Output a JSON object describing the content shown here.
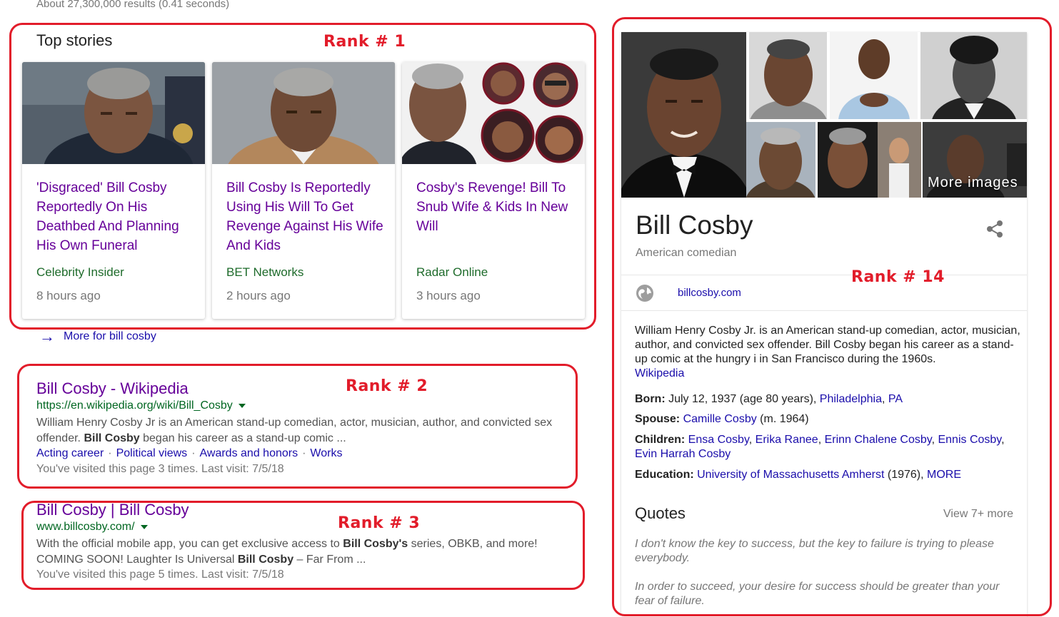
{
  "results_stats": "About 27,300,000 results (0.41 seconds)",
  "annotations": {
    "rank1": "Rank # 1",
    "rank2": "Rank # 2",
    "rank3": "Rank # 3",
    "rank14": "Rank # 14",
    "box_color": "#e21c2a"
  },
  "top_stories": {
    "heading": "Top stories",
    "cards": [
      {
        "title": "'Disgraced' Bill Cosby Reportedly On His Deathbed And Planning His Own Funeral",
        "source": "Celebrity Insider",
        "time": "8 hours ago"
      },
      {
        "title": "Bill Cosby Is Reportedly Using His Will To Get Revenge Against His Wife And Kids",
        "source": "BET Networks",
        "time": "2 hours ago"
      },
      {
        "title": "Cosby's Revenge! Bill To Snub Wife & Kids In New Will",
        "source": "Radar Online",
        "time": "3 hours ago"
      }
    ],
    "more_link": "More for bill cosby",
    "more_icon": "arrow-right-icon"
  },
  "results": [
    {
      "title": "Bill Cosby - Wikipedia",
      "url": "https://en.wikipedia.org/wiki/Bill_Cosby",
      "snippet_1": "William Henry Cosby Jr is an American stand-up comedian, actor, musician, author, and convicted sex",
      "snippet_2a": "offender. ",
      "snippet_2b": "Bill Cosby",
      "snippet_2c": " began his career as a stand-up comic ...",
      "sitelinks": [
        "Acting career",
        "Political views",
        "Awards and honors",
        "Works"
      ],
      "visited": "You've visited this page 3 times. Last visit: 7/5/18"
    },
    {
      "title": "Bill Cosby | Bill Cosby",
      "url": "www.billcosby.com/",
      "snippet_1a": "With the official mobile app, you can get exclusive access to ",
      "snippet_1b": "Bill Cosby's",
      "snippet_1c": " series, OBKB, and more!",
      "snippet_2a": "COMING SOON! Laughter Is Universal ",
      "snippet_2b": "Bill Cosby",
      "snippet_2c": " – Far From ...",
      "visited": "You've visited this page 5 times. Last visit: 7/5/18"
    }
  ],
  "knowledge_panel": {
    "title": "Bill Cosby",
    "subtitle": "American comedian",
    "share_icon": "share-icon",
    "website_icon": "globe-icon",
    "website": "billcosby.com",
    "more_images": "More images",
    "description": "William Henry Cosby Jr. is an American stand-up comedian, actor, musician, author, and convicted sex offender. Bill Cosby began his career as a stand-up comic at the hungry i in San Francisco during the 1960s.",
    "description_source": "Wikipedia",
    "born_label": "Born:",
    "born_value": " July 12, 1937 (age 80 years), ",
    "born_place1": "Philadelphia",
    "born_sep": ", ",
    "born_place2": "PA",
    "spouse_label": "Spouse:",
    "spouse_link": "Camille Cosby",
    "spouse_rest": " (m. 1964)",
    "children_label": "Children:",
    "children": [
      "Ensa Cosby",
      "Erika Ranee",
      "Erinn Chalene Cosby",
      "Ennis Cosby",
      "Evin Harrah Cosby"
    ],
    "education_label": "Education:",
    "education_link": "University of Massachusetts Amherst",
    "education_year": " (1976), ",
    "education_more": "MORE",
    "quotes_heading": "Quotes",
    "quotes_more": "View 7+ more",
    "quotes": [
      "I don't know the key to success, but the key to failure is trying to please everybody.",
      "In order to succeed, your desire for success should be greater than your fear of failure."
    ]
  }
}
